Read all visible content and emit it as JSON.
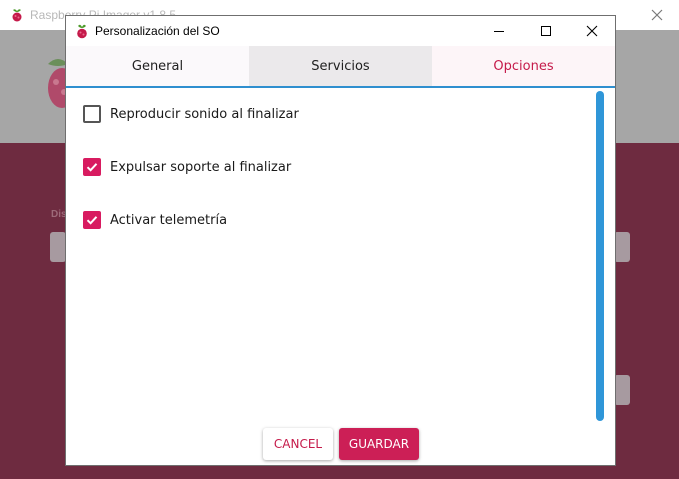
{
  "background_window": {
    "title": "Raspberry Pi Imager v1.8.5",
    "section_label": "Dis",
    "colors": {
      "header": "#a6a6a6",
      "body": "#6e2b40"
    }
  },
  "dialog": {
    "title": "Personalización del SO",
    "window_controls": {
      "minimize": "minimize-icon",
      "maximize": "maximize-icon",
      "close": "close-icon"
    },
    "tabs": [
      {
        "label": "General",
        "selected": false
      },
      {
        "label": "Servicios",
        "selected": false
      },
      {
        "label": "Opciones",
        "selected": true
      }
    ],
    "options": [
      {
        "label": "Reproducir sonido al finalizar",
        "checked": false
      },
      {
        "label": "Expulsar soporte al finalizar",
        "checked": true
      },
      {
        "label": "Activar telemetría",
        "checked": true
      }
    ],
    "buttons": {
      "cancel": "CANCEL",
      "save": "GUARDAR"
    },
    "colors": {
      "accent": "#c51a4a",
      "checkbox": "#d81b60",
      "tab_underline": "#2f8fcf",
      "scrollbar": "#2f96d8"
    }
  }
}
